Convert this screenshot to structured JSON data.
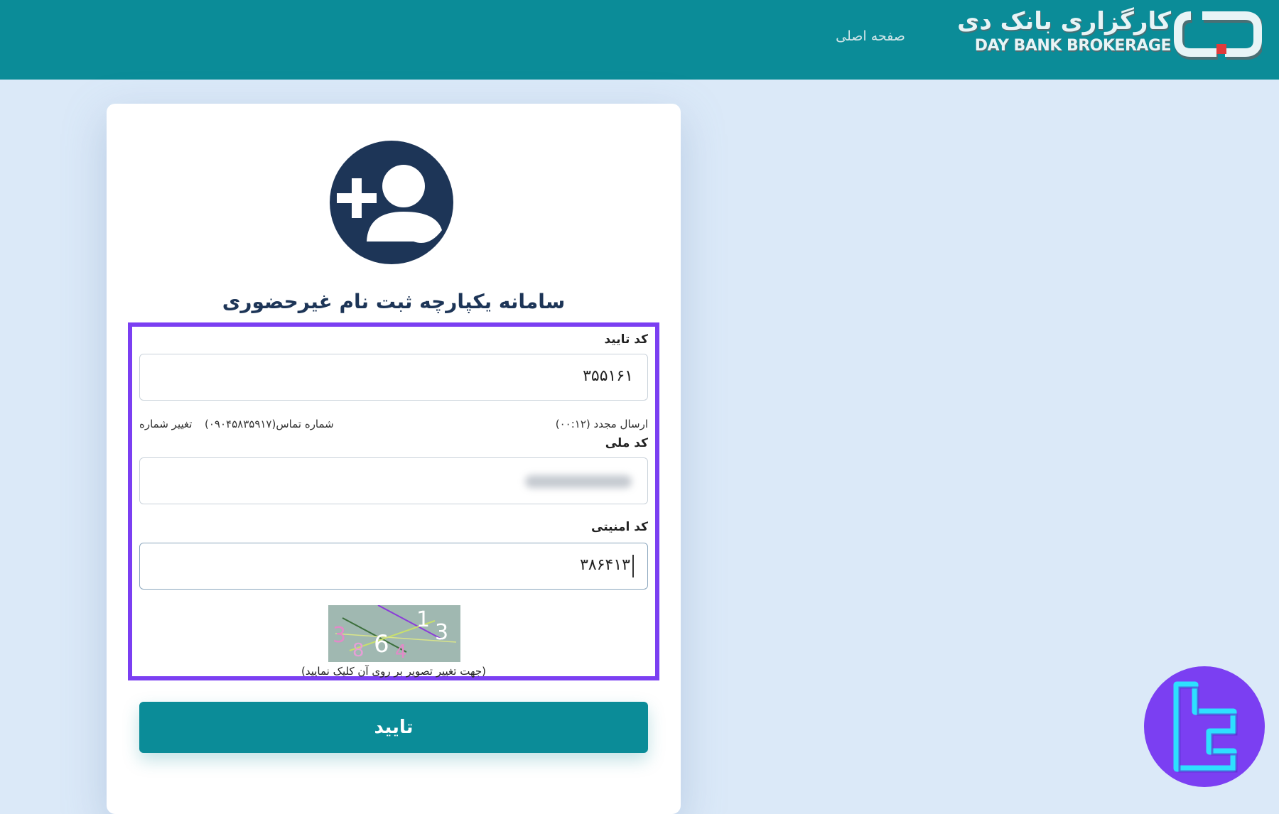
{
  "header": {
    "brand_fa": "کارگزاری بانک دی",
    "brand_en": "DAY BANK BROKERAGE",
    "nav_home": "صفحه اصلی",
    "bg_color": "#0b8c98"
  },
  "form": {
    "title": "سامانه یکپارچه ثبت نام غیرحضوری",
    "verification_code": {
      "label": "کد تایید",
      "value": "۳۵۵۱۶۱"
    },
    "resend": "ارسال مجدد (۰۰:۱۲)",
    "contact_number": "شماره تماس(۰۹۰۴۵۸۳۵۹۱۷)",
    "change_number": "تغییر شماره",
    "national_code": {
      "label": "کد ملی"
    },
    "security_code": {
      "label": "کد امنیتی",
      "value": "۳۸۶۴۱۳"
    },
    "captcha": {
      "digits": [
        "3",
        "8",
        "6",
        "4",
        "1",
        "3"
      ]
    },
    "captcha_hint": "(جهت تغییر تصویر بر روی آن کلیک نمایید)",
    "submit_label": "تایید",
    "highlight_color": "#7b3ff2"
  }
}
